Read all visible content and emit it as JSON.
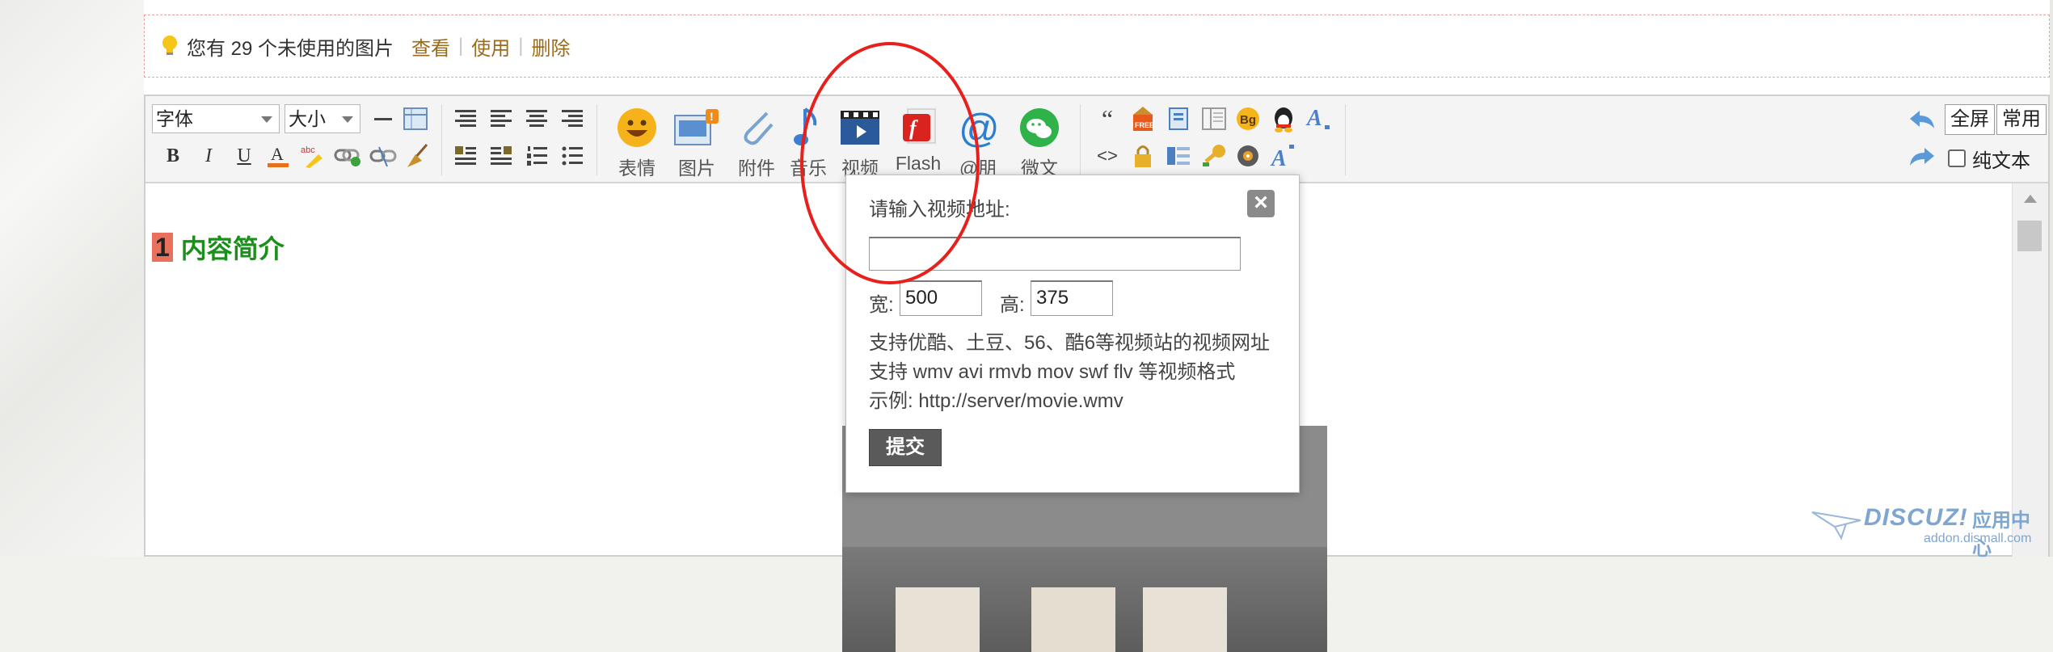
{
  "notice": {
    "message": "您有 29 个未使用的图片",
    "view": "查看",
    "sep": "|",
    "use": "使用",
    "delete": "删除"
  },
  "toolbar": {
    "font_select": "字体",
    "size_select": "大小",
    "big_buttons": {
      "emoji": "表情",
      "image": "图片",
      "attachment": "附件",
      "music": "音乐",
      "video": "视频",
      "flash": "Flash",
      "at": "@朋",
      "wechat": "微文"
    },
    "right": {
      "fullscreen": "全屏",
      "common": "常用",
      "plaintext": "纯文本"
    },
    "icon_text": {
      "quote": "“",
      "code": "<>",
      "bg": "Bg",
      "free": "FREE",
      "a_sub": "A",
      "a_sup": "A"
    }
  },
  "content": {
    "heading_number": "1",
    "heading_text": "内容简介"
  },
  "popup": {
    "prompt": "请输入视频地址:",
    "url_value": "",
    "width_label": "宽:",
    "width_value": "500",
    "height_label": "高:",
    "height_value": "375",
    "info_lines": [
      "支持优酷、土豆、56、酷6等视频站的视频网址",
      "支持 wmv avi rmvb mov swf flv 等视频格式",
      "示例: http://server/movie.wmv"
    ],
    "submit": "提交",
    "close": "×"
  },
  "watermark": {
    "brand": "DISCUZ!",
    "cn": "应用中心",
    "url": "addon.dismall.com"
  },
  "colors": {
    "accent_link": "#9a6b1a",
    "heading_green": "#1a8f1a",
    "heading_number_bg": "#e8705c",
    "annotation_red": "#e8201c"
  }
}
